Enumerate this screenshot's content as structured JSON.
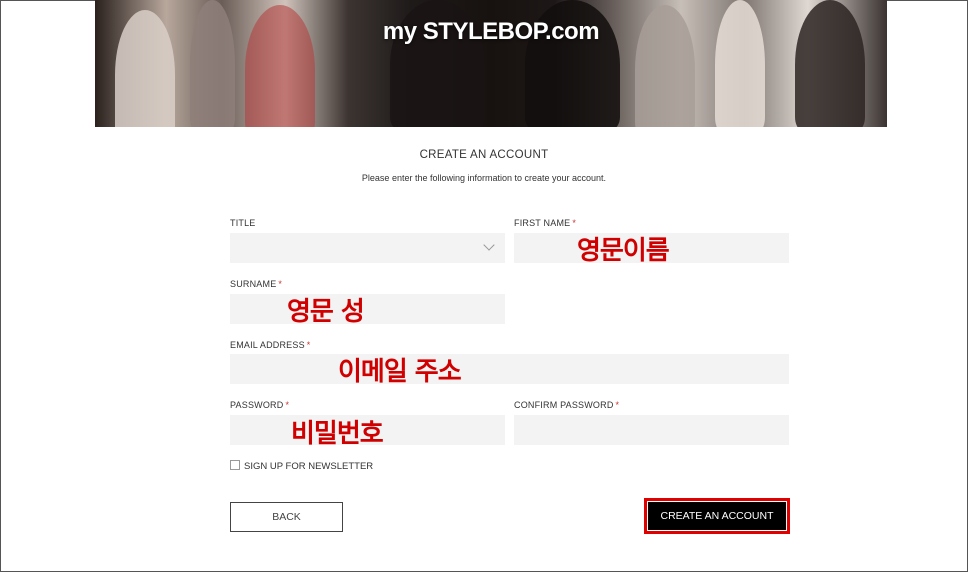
{
  "banner": {
    "brand": "my STYLEBOP.com"
  },
  "form": {
    "heading": "CREATE AN ACCOUNT",
    "subheading": "Please enter the following information to create your account.",
    "required_mark": "*",
    "title_label": "TITLE",
    "first_name_label": "FIRST NAME",
    "surname_label": "SURNAME",
    "email_label": "EMAIL ADDRESS",
    "password_label": "PASSWORD",
    "confirm_password_label": "CONFIRM PASSWORD",
    "newsletter_label": "SIGN UP FOR NEWSLETTER",
    "back_label": "BACK",
    "create_label": "CREATE AN ACCOUNT"
  },
  "annotations": {
    "first_name": "영문이름",
    "surname": "영문 성",
    "email": "이메일 주소",
    "password": "비밀번호"
  },
  "colors": {
    "annotation": "#d00000",
    "highlight_border": "#e00000",
    "field_bg": "#f3f3f3",
    "primary_button": "#000000"
  }
}
